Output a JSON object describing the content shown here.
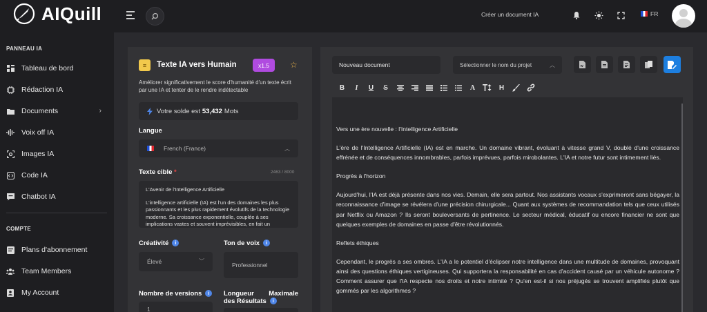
{
  "header": {
    "brand": "AIQuill",
    "create_doc": "Créer un document IA",
    "lang": "FR"
  },
  "sidebar": {
    "section1": "PANNEAU IA",
    "items": [
      {
        "label": "Tableau de bord",
        "icon": "dashboard-icon"
      },
      {
        "label": "Rédaction IA",
        "icon": "chip-icon"
      },
      {
        "label": "Documents",
        "icon": "folder-icon"
      },
      {
        "label": "Voix off IA",
        "icon": "waveform-icon"
      },
      {
        "label": "Images IA",
        "icon": "image-icon"
      },
      {
        "label": "Code IA",
        "icon": "code-icon"
      },
      {
        "label": "Chatbot IA",
        "icon": "chat-icon"
      }
    ],
    "section2": "COMPTE",
    "account_items": [
      {
        "label": "Plans d'abonnement",
        "icon": "plans-icon"
      },
      {
        "label": "Team Members",
        "icon": "team-icon"
      },
      {
        "label": "My Account",
        "icon": "account-icon"
      }
    ]
  },
  "tool": {
    "title": "Texte IA vers Humain",
    "badge": "x1.5",
    "description": "Améliorer significativement le score d'humanité d'un texte écrit par une IA et tenter de le rendre indétectable",
    "balance_prefix": "Votre solde est",
    "balance_value": "53,432",
    "balance_suffix": "Mots",
    "language_label": "Langue",
    "language_value": "French (France)",
    "target_label": "Texte cible",
    "required_mark": "*",
    "counter": "2463 / 8000",
    "target_p1": "L'Avenir de l'Intelligence Artificielle",
    "target_p2": "L'intelligence artificielle (IA) est l'un des domaines les plus passionnants et les plus rapidement évolutifs de la technologie moderne. Sa croissance exponentielle, couplée à ses implications vastes et souvent imprévisibles, en fait un",
    "creativity_label": "Créativité",
    "creativity_value": "Élevé",
    "tone_label": "Ton de voix",
    "tone_value": "Professionnel",
    "versions_label": "Nombre de versions",
    "versions_value": "1",
    "maxlen_label": "Longueur Maximale des Résultats"
  },
  "editor": {
    "doc_name": "Nouveau document",
    "project_placeholder": "Sélectionner le nom du projet",
    "toolbar": [
      "B",
      "I",
      "U",
      "S",
      "A",
      "H"
    ],
    "paragraphs": [
      "Vers une ère nouvelle : l'Intelligence Artificielle",
      "L'ère de l'Intelligence Artificielle (IA) est en marche. Un domaine vibrant, évoluant à vitesse grand V, doublé d'une croissance effrénée et de conséquences innombrables, parfois imprévues, parfois mirobolantes. L'IA et notre futur sont intimement liés.",
      "Progrès à l'horizon",
      "Aujourd'hui, l'IA est déjà présente dans nos vies. Demain, elle sera partout. Nos assistants vocaux s'exprimeront sans bégayer, la reconnaissance d'image se révélera d'une précision chirurgicale... Quant aux systèmes de recommandation tels que ceux utilisés par Netflix ou Amazon ? Ils seront bouleversants de pertinence. Le secteur médical, éducatif ou encore financier ne sont que quelques exemples de domaines en passe d'être révolutionnés.",
      "Reflets éthiques",
      "Cependant, le progrès a ses ombres. L'IA a le potentiel d'éclipser notre intelligence dans une multitude de domaines, provoquant ainsi des questions éthiques vertigineuses. Qui supportera la responsabilité en cas d'accident causé par un véhicule autonome ? Comment assurer que l'IA respecte nos droits et notre intimité ? Qu'en est-il si nos préjugés se trouvent amplifiés plutôt que gommés par les algorithmes ?"
    ]
  },
  "colors": {
    "accent": "#1d7fe0",
    "badge": "#b04be0",
    "star": "#f2b84b"
  }
}
